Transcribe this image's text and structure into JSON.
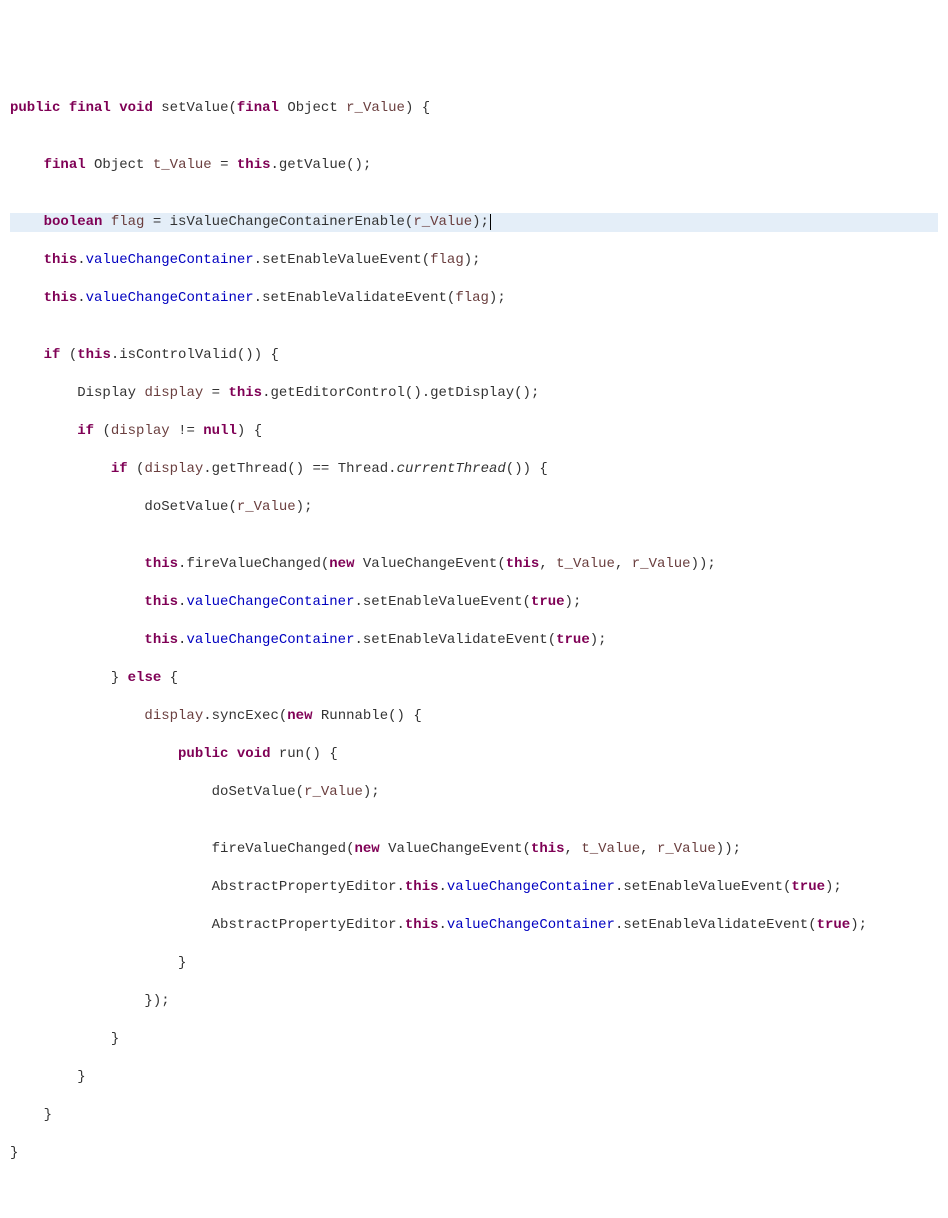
{
  "code": {
    "kw": {
      "public": "public",
      "final": "final",
      "void": "void",
      "boolean": "boolean",
      "this": "this",
      "if": "if",
      "null": "null",
      "new": "new",
      "else": "else",
      "true": "true"
    },
    "id": {
      "setValue": "setValue",
      "Object": "Object",
      "r_Value": "r_Value",
      "t_Value": "t_Value",
      "getValue": "getValue",
      "flag": "flag",
      "isValueChangeContainerEnable": "isValueChangeContainerEnable",
      "valueChangeContainer": "valueChangeContainer",
      "setEnableValueEvent": "setEnableValueEvent",
      "setEnableValidateEvent": "setEnableValidateEvent",
      "isControlValid": "isControlValid",
      "Display": "Display",
      "display": "display",
      "getEditorControl": "getEditorControl",
      "getDisplay": "getDisplay",
      "getThread": "getThread",
      "Thread": "Thread",
      "currentThread": "currentThread",
      "doSetValue": "doSetValue",
      "fireValueChanged": "fireValueChanged",
      "ValueChangeEvent": "ValueChangeEvent",
      "syncExec": "syncExec",
      "Runnable": "Runnable",
      "run": "run",
      "AbstractPropertyEditor": "AbstractPropertyEditor"
    },
    "p": {
      "op": "(",
      "cp": ")",
      "oc": "{",
      "cc": "}",
      "sc": ";",
      "comma": ",",
      "dot": ".",
      "eq": "=",
      "eqeq": "==",
      "neq": "!="
    }
  }
}
